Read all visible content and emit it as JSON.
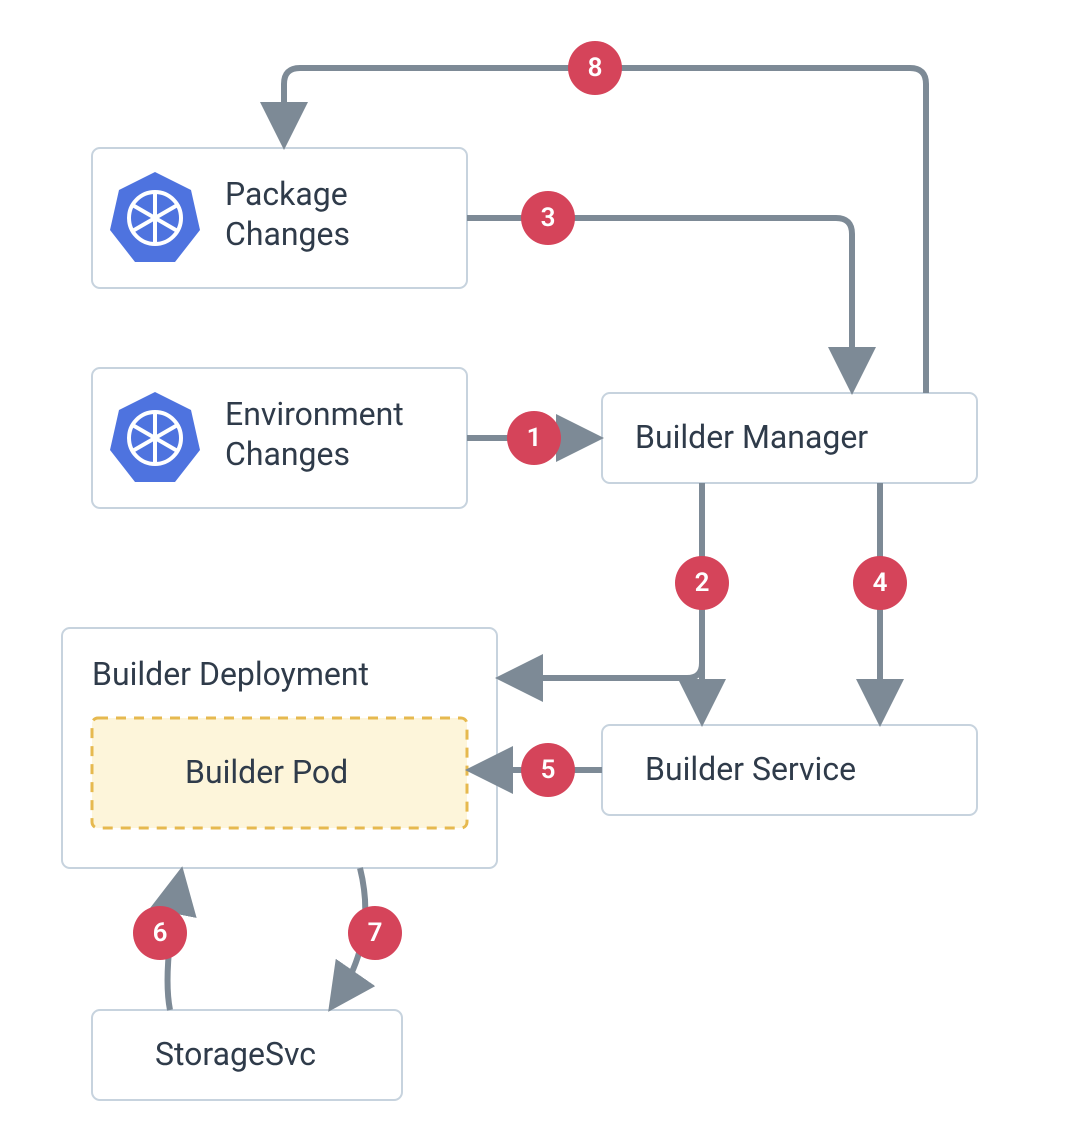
{
  "nodes": {
    "package_changes": {
      "line1": "Package",
      "line2": "Changes"
    },
    "environment_changes": {
      "line1": "Environment",
      "line2": "Changes"
    },
    "builder_manager": "Builder Manager",
    "builder_deployment": "Builder Deployment",
    "builder_pod": "Builder Pod",
    "builder_service": "Builder Service",
    "storage_svc": "StorageSvc"
  },
  "steps": {
    "s1": "1",
    "s2": "2",
    "s3": "3",
    "s4": "4",
    "s5": "5",
    "s6": "6",
    "s7": "7",
    "s8": "8"
  },
  "flow_description": [
    "1: Environment Changes → Builder Manager",
    "2: Builder Manager → Builder Deployment (and down toward Builder Service)",
    "3: Package Changes → Builder Manager",
    "4: Builder Manager → Builder Service",
    "5: Builder Service → Builder Pod",
    "6: StorageSvc → Builder Pod",
    "7: Builder Pod → StorageSvc",
    "8: Builder Manager → Package Changes"
  ],
  "colors": {
    "box_border": "#c7d3de",
    "box_bg": "#ffffff",
    "pod_border": "#e6b94f",
    "pod_bg": "#fdf5da",
    "arrow": "#7d8a96",
    "badge": "#d5445a",
    "k8s_icon": "#4e73df",
    "text": "#2f3b4a"
  }
}
